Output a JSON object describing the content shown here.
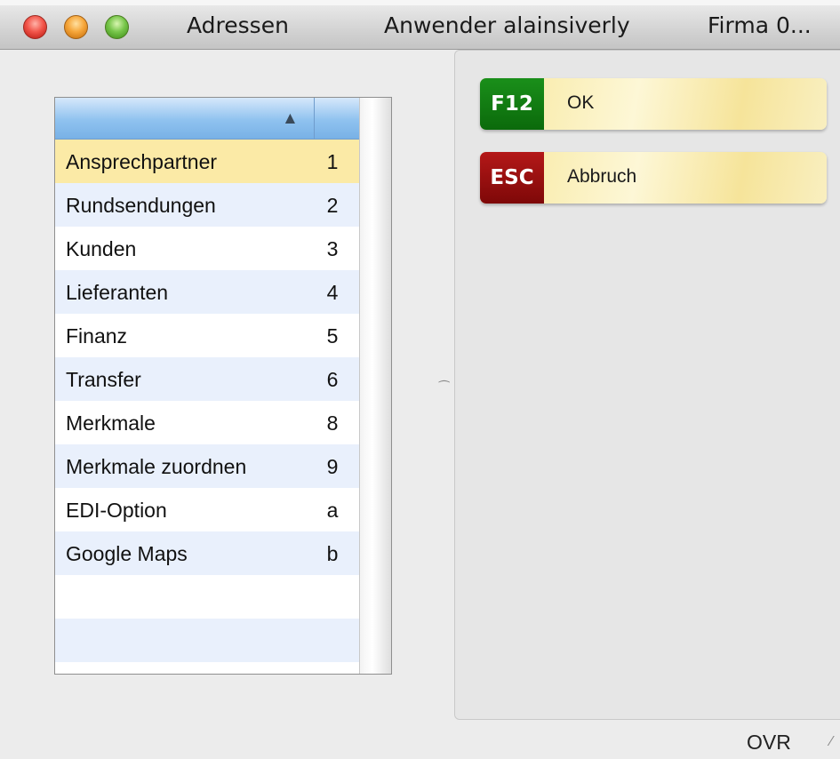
{
  "window": {
    "title_segments": [
      "Adressen",
      "Anwender alainsiverly",
      "Firma 0..."
    ]
  },
  "list": {
    "sort_indicator": "▲",
    "rows": [
      {
        "label": "Ansprechpartner",
        "key": "1"
      },
      {
        "label": "Rundsendungen",
        "key": "2"
      },
      {
        "label": "Kunden",
        "key": "3"
      },
      {
        "label": "Lieferanten",
        "key": "4"
      },
      {
        "label": "Finanz",
        "key": "5"
      },
      {
        "label": "Transfer",
        "key": "6"
      },
      {
        "label": "Merkmale",
        "key": "8"
      },
      {
        "label": "Merkmale zuordnen",
        "key": "9"
      },
      {
        "label": "EDI-Option",
        "key": "a"
      },
      {
        "label": "Google Maps",
        "key": "b"
      },
      {
        "label": "",
        "key": ""
      },
      {
        "label": "",
        "key": ""
      }
    ],
    "selected_index": 0
  },
  "actions": {
    "ok": {
      "key": "F12",
      "label": "OK",
      "color": "#0b6a0b"
    },
    "cancel": {
      "key": "ESC",
      "label": "Abbruch",
      "color": "#7e0808"
    }
  },
  "status": {
    "mode": "OVR"
  }
}
